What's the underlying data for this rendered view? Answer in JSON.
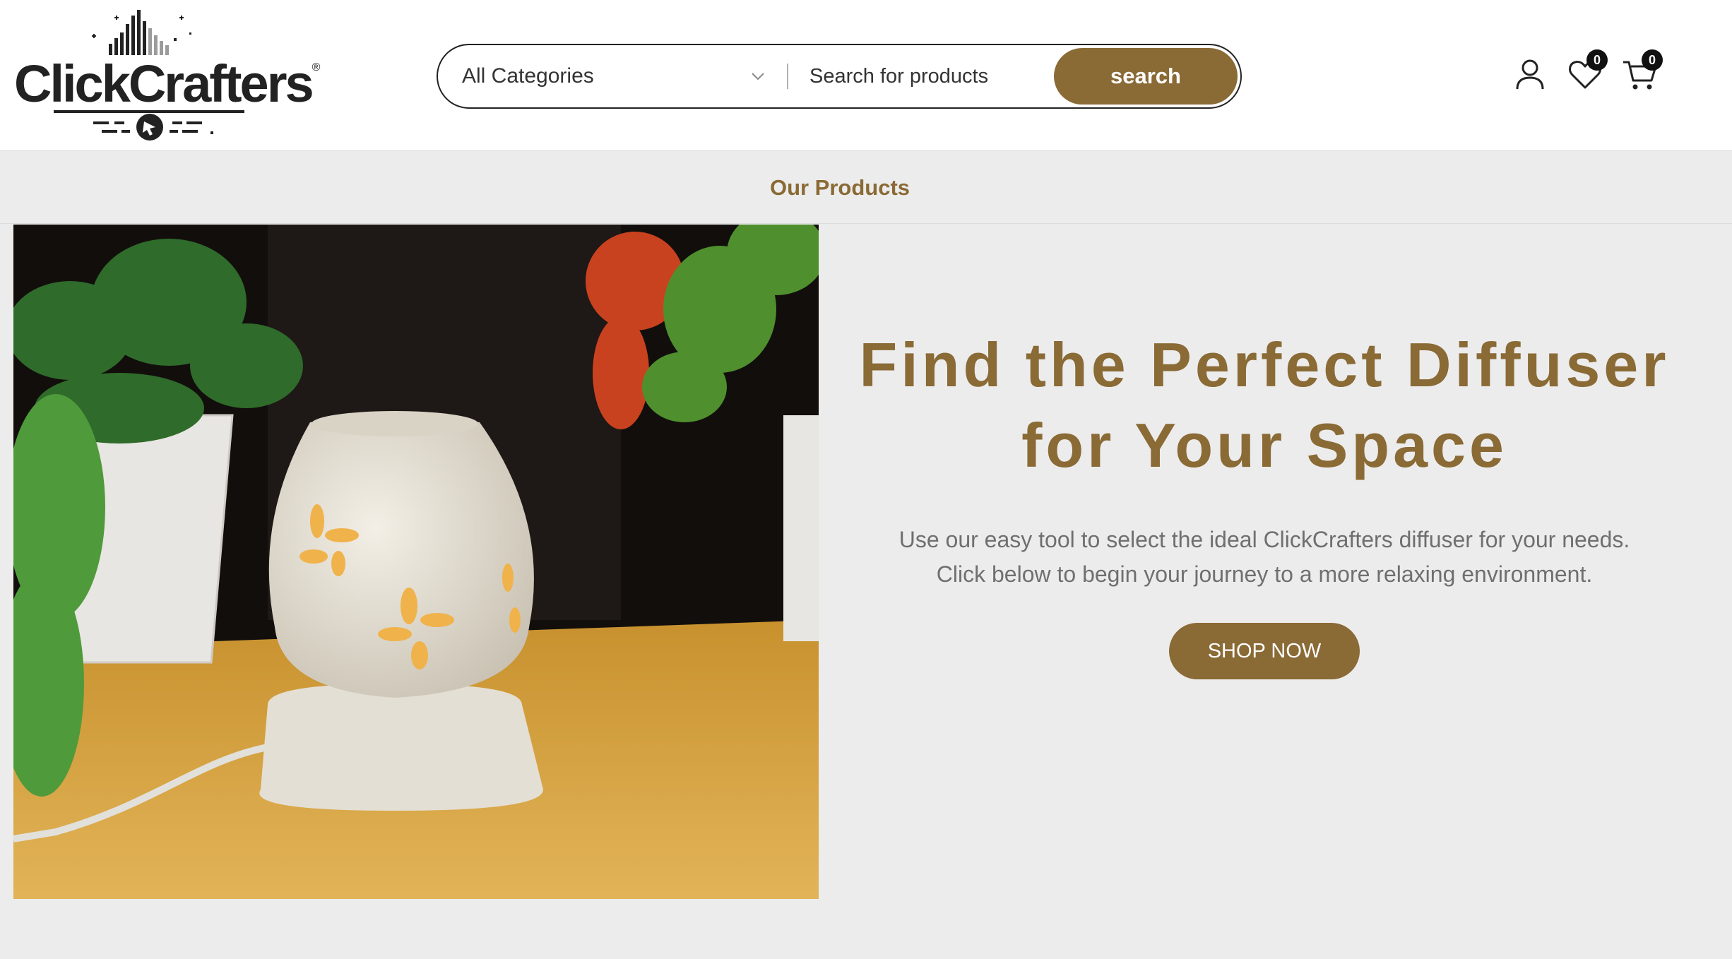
{
  "brand": {
    "logo_text": "ClickCrafters",
    "trademark": "®"
  },
  "search": {
    "category_selected": "All Categories",
    "placeholder": "Search for products",
    "button_label": "search"
  },
  "header_icons": [
    {
      "name": "account-icon"
    },
    {
      "name": "wishlist-icon",
      "count": "0"
    },
    {
      "name": "cart-icon",
      "count": "0"
    }
  ],
  "nav": {
    "items": [
      {
        "label": "Our Products"
      }
    ]
  },
  "hero": {
    "title_line1": "Find the Perfect Diffuser",
    "title_line2": "for Your Space",
    "subtitle_line1": "Use our easy tool to select the ideal ClickCrafters diffuser for your needs.",
    "subtitle_line2": "Click below to begin your journey to a more relaxing environment.",
    "cta_label": "SHOP NOW"
  },
  "colors": {
    "accent": "#8a6a35",
    "page_bg": "#ececec",
    "header_bg": "#ffffff",
    "text_muted": "#6f6f6f"
  }
}
